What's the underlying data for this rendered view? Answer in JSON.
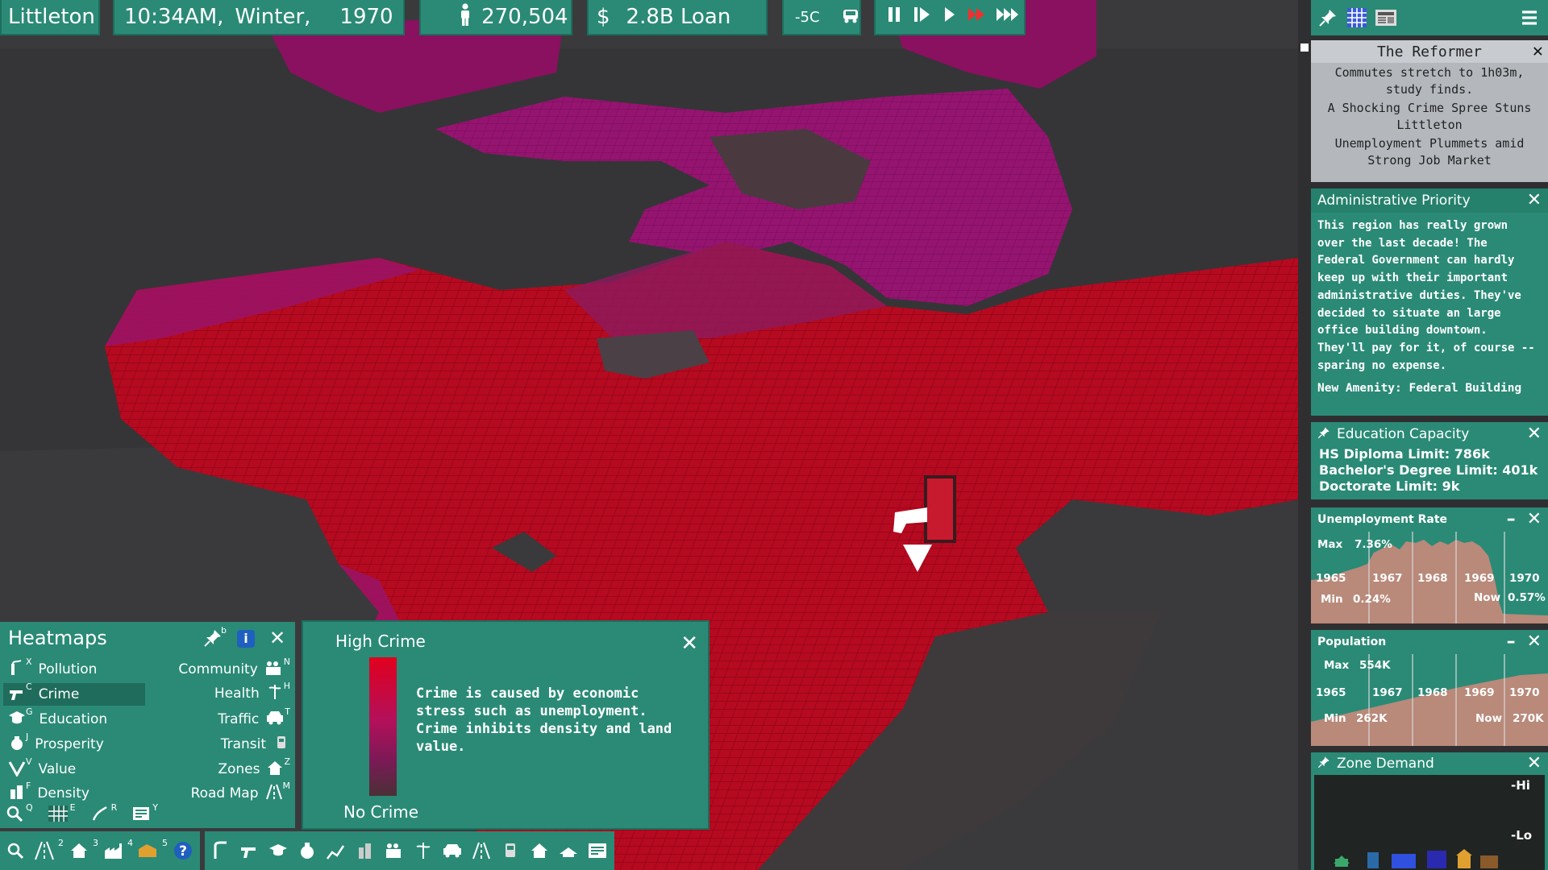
{
  "top_bar": {
    "city_name": "Littleton",
    "time": "10:34AM,",
    "season": "Winter,",
    "year": "1970",
    "population": "270,504",
    "money": "2.8B Loan",
    "temperature": "-5C",
    "speed_controls": [
      "pause-icon",
      "step-icon",
      "play-icon",
      "fast-icon",
      "fastest-icon"
    ]
  },
  "sidebar": {
    "toolbar_icons": [
      "pin-icon",
      "grid-icon",
      "newspaper-icon",
      "menu-icon"
    ],
    "newspaper": {
      "title": "The Reformer",
      "headlines": [
        "Commutes stretch to 1h03m, study finds.",
        "A Shocking Crime Spree Stuns Littleton",
        "Unemployment Plummets amid Strong Job Market"
      ]
    },
    "admin_priority": {
      "title": "Administrative Priority",
      "body": "This region has really grown over the last decade! The Federal Government can hardly keep up with their important administrative duties. They've decided to situate an large office building downtown. They'll pay for it, of course -- sparing no expense.",
      "amenity": "New Amenity: Federal Building"
    },
    "education": {
      "title": "Education Capacity",
      "rows": [
        "HS Diploma Limit: 786k",
        "Bachelor's Degree Limit: 401k",
        "Doctorate Limit: 9k"
      ]
    },
    "unemployment": {
      "title": "Unemployment Rate",
      "max_label": "Max",
      "max_value": "7.36%",
      "min_label": "Min",
      "min_value": "0.24%",
      "now_label": "Now",
      "now_value": "0.57%",
      "years": [
        "1965",
        "1967",
        "1968",
        "1969",
        "1970"
      ]
    },
    "population_graph": {
      "title": "Population",
      "max_label": "Max",
      "max_value": "554K",
      "min_label": "Min",
      "min_value": "262K",
      "now_label": "Now",
      "now_value": "270K",
      "years": [
        "1965",
        "1967",
        "1968",
        "1969",
        "1970"
      ]
    },
    "zone_demand": {
      "title": "Zone Demand",
      "hi": "-Hi",
      "lo": "-Lo"
    }
  },
  "heatmaps": {
    "title": "Heatmaps",
    "left": [
      {
        "label": "Pollution",
        "key": "X"
      },
      {
        "label": "Crime",
        "key": "C"
      },
      {
        "label": "Education",
        "key": "G"
      },
      {
        "label": "Prosperity",
        "key": "J"
      },
      {
        "label": "Value",
        "key": "V"
      },
      {
        "label": "Density",
        "key": "F"
      }
    ],
    "right": [
      {
        "label": "Community",
        "key": "N"
      },
      {
        "label": "Health",
        "key": "H"
      },
      {
        "label": "Traffic",
        "key": "T"
      },
      {
        "label": "Transit",
        "key": ""
      },
      {
        "label": "Zones",
        "key": "Z"
      },
      {
        "label": "Road Map",
        "key": "M"
      }
    ],
    "selected": "Crime",
    "header_key": "b",
    "bottom_keys": [
      "Q",
      "E",
      "R",
      "Y"
    ]
  },
  "legend": {
    "high": "High Crime",
    "low": "No Crime",
    "description": "Crime is caused by economic stress such as unemployment. Crime inhibits density and land value.",
    "colors": {
      "high": "#e0001e",
      "low": "#4a3036"
    }
  },
  "bottom_toolbar": {
    "keys": [
      "2",
      "3",
      "4",
      "5"
    ]
  },
  "colors": {
    "panel": "#2a8a76",
    "crime_high": "#c8001a",
    "crime_mid": "#a0166a"
  }
}
